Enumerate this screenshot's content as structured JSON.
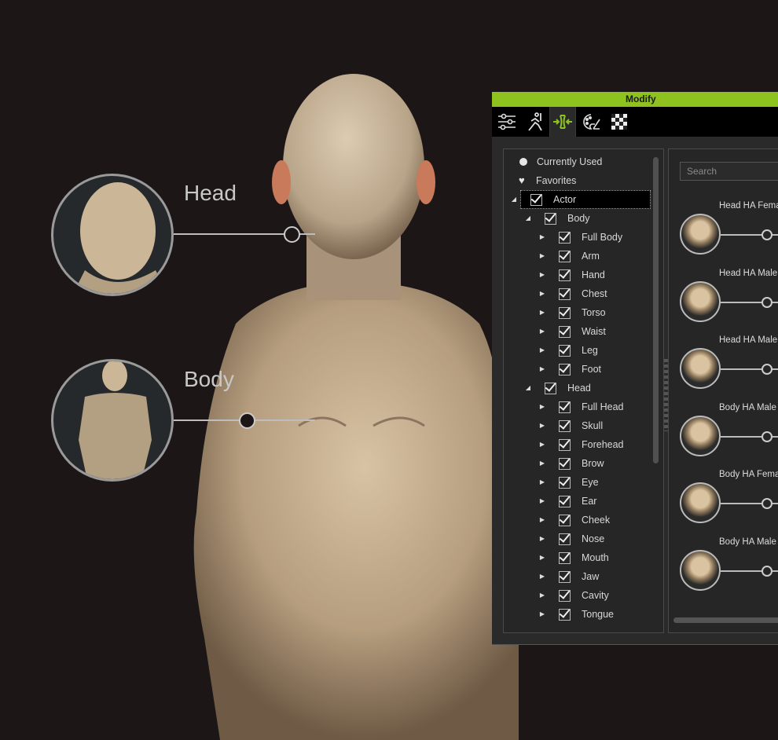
{
  "callouts": [
    {
      "label": "Head",
      "thumb": "elderly-head-sculpt",
      "value": 0.75
    },
    {
      "label": "Body",
      "thumb": "elderly-body-sculpt",
      "value": 0.5
    }
  ],
  "panel": {
    "title": "Modify",
    "accent": "#8dc21f",
    "tabs": [
      {
        "icon": "sliders-icon",
        "active": false
      },
      {
        "icon": "motion-icon",
        "active": false
      },
      {
        "icon": "morph-icon",
        "active": true
      },
      {
        "icon": "material-palette-icon",
        "active": false
      },
      {
        "icon": "checker-texture-icon",
        "active": false
      }
    ],
    "tree": [
      {
        "label": "Currently Used",
        "icon": "bullet",
        "level": 0
      },
      {
        "label": "Favorites",
        "icon": "heart",
        "level": 0
      },
      {
        "label": "Actor",
        "arrow": "expanded",
        "checked": true,
        "level": 0,
        "selected": true
      },
      {
        "label": "Body",
        "arrow": "expanded",
        "checked": true,
        "level": 1
      },
      {
        "label": "Full Body",
        "arrow": "collapsed",
        "checked": true,
        "level": 2
      },
      {
        "label": "Arm",
        "arrow": "collapsed",
        "checked": true,
        "level": 2
      },
      {
        "label": "Hand",
        "arrow": "collapsed",
        "checked": true,
        "level": 2
      },
      {
        "label": "Chest",
        "arrow": "collapsed",
        "checked": true,
        "level": 2
      },
      {
        "label": "Torso",
        "arrow": "collapsed",
        "checked": true,
        "level": 2
      },
      {
        "label": "Waist",
        "arrow": "collapsed",
        "checked": true,
        "level": 2
      },
      {
        "label": "Leg",
        "arrow": "collapsed",
        "checked": true,
        "level": 2
      },
      {
        "label": "Foot",
        "arrow": "collapsed",
        "checked": true,
        "level": 2
      },
      {
        "label": "Head",
        "arrow": "expanded",
        "checked": true,
        "level": 1
      },
      {
        "label": "Full Head",
        "arrow": "collapsed",
        "checked": true,
        "level": 2
      },
      {
        "label": "Skull",
        "arrow": "collapsed",
        "checked": true,
        "level": 2
      },
      {
        "label": "Forehead",
        "arrow": "collapsed",
        "checked": true,
        "level": 2
      },
      {
        "label": "Brow",
        "arrow": "collapsed",
        "checked": true,
        "level": 2
      },
      {
        "label": "Eye",
        "arrow": "collapsed",
        "checked": true,
        "level": 2
      },
      {
        "label": "Ear",
        "arrow": "collapsed",
        "checked": true,
        "level": 2
      },
      {
        "label": "Cheek",
        "arrow": "collapsed",
        "checked": true,
        "level": 2
      },
      {
        "label": "Nose",
        "arrow": "collapsed",
        "checked": true,
        "level": 2
      },
      {
        "label": "Mouth",
        "arrow": "collapsed",
        "checked": true,
        "level": 2
      },
      {
        "label": "Jaw",
        "arrow": "collapsed",
        "checked": true,
        "level": 2
      },
      {
        "label": "Cavity",
        "arrow": "collapsed",
        "checked": true,
        "level": 2
      },
      {
        "label": "Tongue",
        "arrow": "collapsed",
        "checked": true,
        "level": 2
      }
    ],
    "search_placeholder": "Search",
    "morphs": [
      {
        "label": "Head HA Female",
        "value": 0.5
      },
      {
        "label": "Head HA Male",
        "value": 0.5
      },
      {
        "label": "Head HA Male",
        "value": 0.5
      },
      {
        "label": "Body HA Male",
        "value": 0.5
      },
      {
        "label": "Body HA Female",
        "value": 0.5
      },
      {
        "label": "Body HA Male",
        "value": 0.5
      }
    ]
  }
}
